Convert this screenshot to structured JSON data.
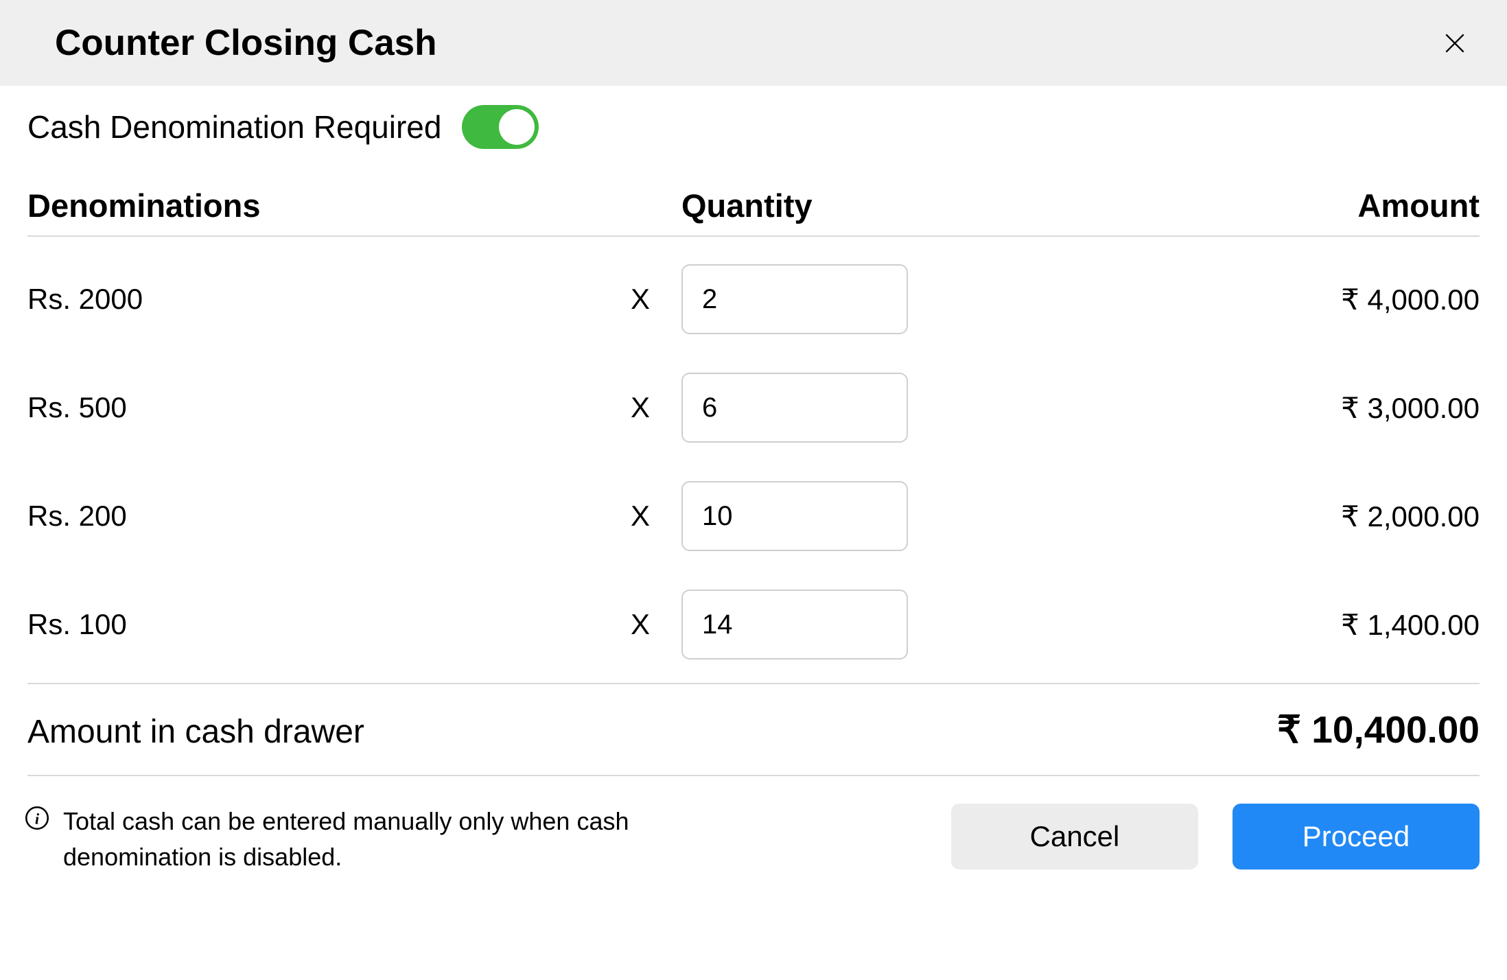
{
  "header": {
    "title": "Counter Closing Cash"
  },
  "toggle": {
    "label": "Cash Denomination Required",
    "state": true
  },
  "table": {
    "headers": {
      "denominations": "Denominations",
      "quantity": "Quantity",
      "amount": "Amount"
    },
    "multiply_symbol": "X",
    "rows": [
      {
        "denomination": "Rs. 2000",
        "quantity": "2",
        "amount": "₹ 4,000.00"
      },
      {
        "denomination": "Rs. 500",
        "quantity": "6",
        "amount": "₹ 3,000.00"
      },
      {
        "denomination": "Rs. 200",
        "quantity": "10",
        "amount": "₹ 2,000.00"
      },
      {
        "denomination": "Rs. 100",
        "quantity": "14",
        "amount": "₹ 1,400.00"
      }
    ]
  },
  "total": {
    "label": "Amount in cash drawer",
    "amount": "₹ 10,400.00"
  },
  "footer": {
    "info_text": "Total cash can be entered manually only when cash denomination is disabled.",
    "cancel_label": "Cancel",
    "proceed_label": "Proceed"
  }
}
